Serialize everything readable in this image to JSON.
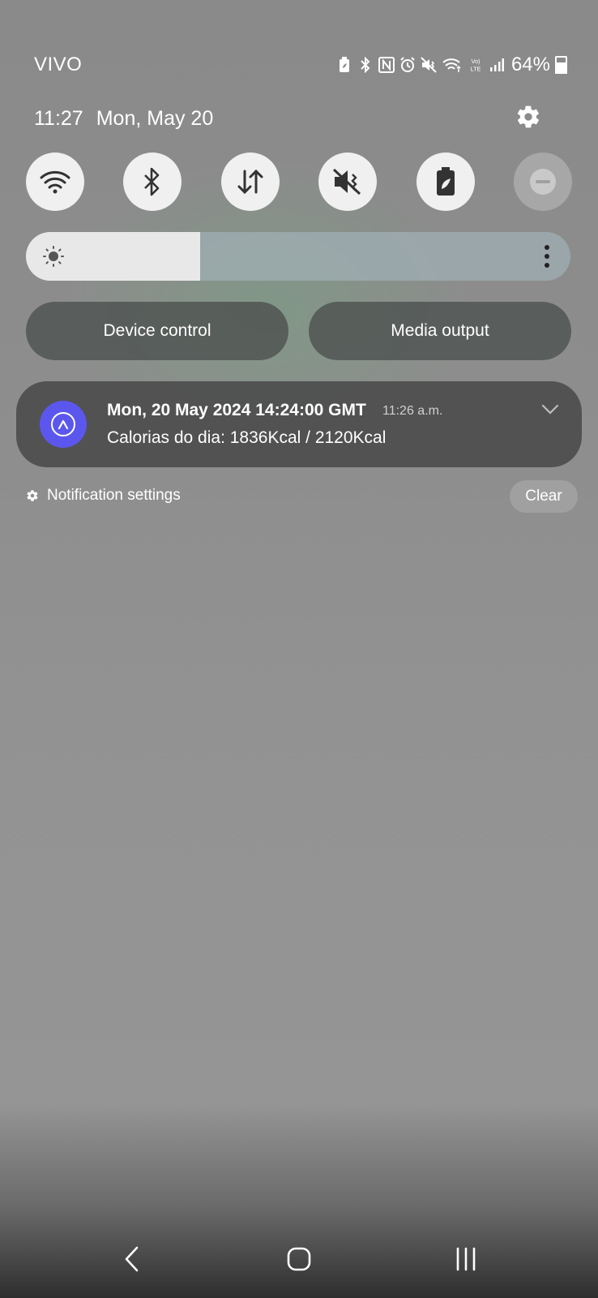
{
  "status_bar": {
    "carrier": "VIVO",
    "battery_percent": "64%",
    "icons": [
      "battery-saver-icon",
      "bluetooth-icon",
      "nfc-icon",
      "alarm-icon",
      "mute-icon",
      "wifi-icon",
      "volte-icon",
      "signal-icon",
      "battery-icon"
    ]
  },
  "header": {
    "time": "11:27",
    "date": "Mon, May 20"
  },
  "quick_settings": [
    {
      "name": "wifi",
      "state": "on"
    },
    {
      "name": "bluetooth",
      "state": "on"
    },
    {
      "name": "mobile-data",
      "state": "on"
    },
    {
      "name": "mute",
      "state": "on"
    },
    {
      "name": "power-saving",
      "state": "on"
    },
    {
      "name": "do-not-disturb",
      "state": "off"
    }
  ],
  "brightness": {
    "level": 0.32
  },
  "buttons": {
    "device_control": "Device control",
    "media_output": "Media output"
  },
  "notification": {
    "title": "Mon, 20 May 2024 14:24:00 GMT",
    "time": "11:26 a.m.",
    "body": "Calorias do dia: 1836Kcal / 2120Kcal",
    "app_color": "#5b57ee"
  },
  "footer": {
    "notification_settings": "Notification settings",
    "clear": "Clear"
  }
}
